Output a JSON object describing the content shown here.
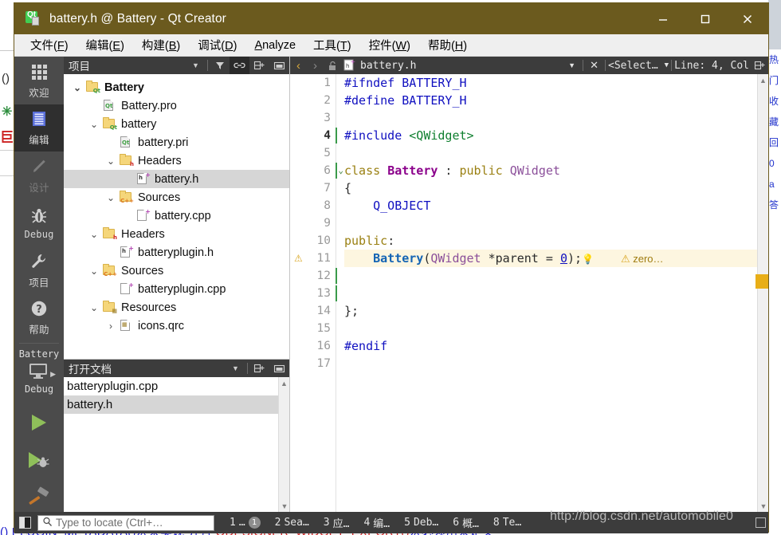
{
  "window": {
    "title": "battery.h @ Battery - Qt Creator",
    "logo_icon": "qt-logo-icon",
    "minimize_icon": "minimize-icon",
    "maximize_icon": "maximize-icon",
    "close_icon": "close-icon"
  },
  "menubar": {
    "items": [
      {
        "pre": "文件(",
        "key": "F",
        "post": ")"
      },
      {
        "pre": "编辑(",
        "key": "E",
        "post": ")"
      },
      {
        "pre": "构建(",
        "key": "B",
        "post": ")"
      },
      {
        "pre": "调试(",
        "key": "D",
        "post": ")"
      },
      {
        "pre": "",
        "key": "A",
        "post": "nalyze"
      },
      {
        "pre": "工具(",
        "key": "T",
        "post": ")"
      },
      {
        "pre": "控件(",
        "key": "W",
        "post": ")"
      },
      {
        "pre": "帮助(",
        "key": "H",
        "post": ")"
      }
    ]
  },
  "modebar": {
    "modes": [
      {
        "label": "欢迎",
        "icon": "grid-icon",
        "state": "normal"
      },
      {
        "label": "编辑",
        "icon": "document-lines-icon",
        "state": "active"
      },
      {
        "label": "设计",
        "icon": "pencil-icon",
        "state": "disabled"
      },
      {
        "label": "Debug",
        "icon": "bug-icon",
        "state": "normal"
      },
      {
        "label": "项目",
        "icon": "wrench-icon",
        "state": "normal"
      },
      {
        "label": "帮助",
        "icon": "question-mark-icon",
        "state": "normal"
      }
    ],
    "kit": {
      "project_name": "Battery",
      "icon": "monitor-icon",
      "arrow_icon": "play-arrow-small-icon",
      "build_config": "Debug"
    },
    "actions": [
      {
        "name": "run-button",
        "icon": "green-play-icon"
      },
      {
        "name": "debug-button",
        "icon": "green-play-bug-icon"
      },
      {
        "name": "build-button",
        "icon": "hammer-icon"
      }
    ]
  },
  "project_panel": {
    "title": "项目",
    "tools": [
      {
        "name": "filter-dropdown-icon",
        "glyph": "▾"
      },
      {
        "name": "filter-icon",
        "glyph": "filter"
      },
      {
        "name": "link-sync-icon",
        "glyph": "link",
        "active": true
      },
      {
        "name": "split-add-icon",
        "glyph": "split"
      },
      {
        "name": "minimize-panel-icon",
        "glyph": "min"
      }
    ],
    "tree": [
      {
        "label": "Battery",
        "indent": 0,
        "arrow": "down",
        "icon": "folder-qt",
        "bold": true,
        "selected": false
      },
      {
        "label": "Battery.pro",
        "indent": 1,
        "arrow": "none",
        "icon": "file-qt",
        "bold": false,
        "selected": false
      },
      {
        "label": "battery",
        "indent": 1,
        "arrow": "down",
        "icon": "folder-qt",
        "bold": false,
        "selected": false
      },
      {
        "label": "battery.pri",
        "indent": 2,
        "arrow": "none",
        "icon": "file-qt",
        "bold": false,
        "selected": false
      },
      {
        "label": "Headers",
        "indent": 2,
        "arrow": "down",
        "icon": "folder-h",
        "bold": false,
        "selected": false
      },
      {
        "label": "battery.h",
        "indent": 3,
        "arrow": "none",
        "icon": "file-h",
        "bold": false,
        "selected": true
      },
      {
        "label": "Sources",
        "indent": 2,
        "arrow": "down",
        "icon": "folder-cpp",
        "bold": false,
        "selected": false
      },
      {
        "label": "battery.cpp",
        "indent": 3,
        "arrow": "none",
        "icon": "file-cpp",
        "bold": false,
        "selected": false
      },
      {
        "label": "Headers",
        "indent": 1,
        "arrow": "down",
        "icon": "folder-h",
        "bold": false,
        "selected": false
      },
      {
        "label": "batteryplugin.h",
        "indent": 2,
        "arrow": "none",
        "icon": "file-h",
        "bold": false,
        "selected": false
      },
      {
        "label": "Sources",
        "indent": 1,
        "arrow": "down",
        "icon": "folder-cpp",
        "bold": false,
        "selected": false
      },
      {
        "label": "batteryplugin.cpp",
        "indent": 2,
        "arrow": "none",
        "icon": "file-cpp",
        "bold": false,
        "selected": false
      },
      {
        "label": "Resources",
        "indent": 1,
        "arrow": "down",
        "icon": "folder-res",
        "bold": false,
        "selected": false
      },
      {
        "label": "icons.qrc",
        "indent": 2,
        "arrow": "right",
        "icon": "file-res",
        "bold": false,
        "selected": false
      }
    ]
  },
  "open_documents": {
    "title": "打开文档",
    "tools": [
      {
        "name": "opendocs-dropdown-icon",
        "glyph": "▾"
      },
      {
        "name": "split-add-icon",
        "glyph": "split"
      },
      {
        "name": "minimize-panel-icon",
        "glyph": "min"
      }
    ],
    "items": [
      {
        "label": "battery.h",
        "selected": true
      },
      {
        "label": "batteryplugin.cpp",
        "selected": false
      }
    ]
  },
  "editor": {
    "toolbar": {
      "back_icon": "chevron-left-icon",
      "forward_icon": "chevron-right-icon",
      "lock_icon": "unlocked-icon",
      "file_icon": "header-file-icon",
      "filename": "battery.h",
      "file_dropdown_icon": "chevron-down-icon",
      "close_icon": "close-icon",
      "symbol_selector": "<Select…",
      "symbol_dropdown_icon": "chevron-down-icon",
      "cursor_position": "Line: 4, Col",
      "split_icon": "split-add-icon"
    },
    "lines": [
      {
        "n": 1,
        "current": false,
        "warning": false,
        "fold": false,
        "mark": false,
        "highlight": false,
        "tokens": [
          {
            "t": "#ifndef ",
            "c": "k-pre"
          },
          {
            "t": "BATTERY_H",
            "c": "k-mac"
          }
        ]
      },
      {
        "n": 2,
        "current": false,
        "warning": false,
        "fold": false,
        "mark": false,
        "highlight": false,
        "tokens": [
          {
            "t": "#define ",
            "c": "k-pre"
          },
          {
            "t": "BATTERY_H",
            "c": "k-mac"
          }
        ]
      },
      {
        "n": 3,
        "current": false,
        "warning": false,
        "fold": false,
        "mark": false,
        "highlight": false,
        "tokens": []
      },
      {
        "n": 4,
        "current": true,
        "warning": false,
        "fold": false,
        "mark": true,
        "highlight": false,
        "tokens": [
          {
            "t": "#include ",
            "c": "k-pre"
          },
          {
            "t": "<QWidget>",
            "c": "k-inc"
          }
        ]
      },
      {
        "n": 5,
        "current": false,
        "warning": false,
        "fold": false,
        "mark": false,
        "highlight": false,
        "tokens": []
      },
      {
        "n": 6,
        "current": false,
        "warning": false,
        "fold": true,
        "mark": true,
        "highlight": false,
        "tokens": [
          {
            "t": "class ",
            "c": "k-kw"
          },
          {
            "t": "Battery",
            "c": "k-cls"
          },
          {
            "t": " : ",
            "c": "k-pun"
          },
          {
            "t": "public ",
            "c": "k-kw"
          },
          {
            "t": "QWidget",
            "c": "k-typ"
          }
        ]
      },
      {
        "n": 7,
        "current": false,
        "warning": false,
        "fold": false,
        "mark": false,
        "highlight": false,
        "tokens": [
          {
            "t": "{",
            "c": "k-pun"
          }
        ]
      },
      {
        "n": 8,
        "current": false,
        "warning": false,
        "fold": false,
        "mark": false,
        "highlight": false,
        "tokens": [
          {
            "t": "    ",
            "c": "k-pun"
          },
          {
            "t": "Q_OBJECT",
            "c": "k-mac"
          }
        ]
      },
      {
        "n": 9,
        "current": false,
        "warning": false,
        "fold": false,
        "mark": false,
        "highlight": false,
        "tokens": []
      },
      {
        "n": 10,
        "current": false,
        "warning": false,
        "fold": false,
        "mark": false,
        "highlight": false,
        "tokens": [
          {
            "t": "public",
            "c": "k-kw"
          },
          {
            "t": ":",
            "c": "k-pun"
          }
        ]
      },
      {
        "n": 11,
        "current": false,
        "warning": true,
        "fold": false,
        "mark": false,
        "highlight": true,
        "tokens": [
          {
            "t": "    ",
            "c": "k-pun"
          },
          {
            "t": "Battery",
            "c": "k-fn"
          },
          {
            "t": "(",
            "c": "k-pun"
          },
          {
            "t": "QWidget",
            "c": "k-typ"
          },
          {
            "t": " *parent = ",
            "c": "k-pun"
          },
          {
            "t": "0",
            "c": "k-num"
          },
          {
            "t": ");",
            "c": "k-pun"
          }
        ],
        "bulb": "lightbulb-icon",
        "warning_text": "zero…"
      },
      {
        "n": 12,
        "current": false,
        "warning": false,
        "fold": false,
        "mark": true,
        "highlight": false,
        "tokens": []
      },
      {
        "n": 13,
        "current": false,
        "warning": false,
        "fold": false,
        "mark": true,
        "highlight": false,
        "tokens": []
      },
      {
        "n": 14,
        "current": false,
        "warning": false,
        "fold": false,
        "mark": false,
        "highlight": false,
        "tokens": [
          {
            "t": "};",
            "c": "k-pun"
          }
        ]
      },
      {
        "n": 15,
        "current": false,
        "warning": false,
        "fold": false,
        "mark": false,
        "highlight": false,
        "tokens": []
      },
      {
        "n": 16,
        "current": false,
        "warning": false,
        "fold": false,
        "mark": false,
        "highlight": false,
        "tokens": [
          {
            "t": "#endif",
            "c": "k-pre"
          }
        ]
      },
      {
        "n": 17,
        "current": false,
        "warning": false,
        "fold": false,
        "mark": false,
        "highlight": false,
        "tokens": []
      }
    ],
    "scroll_up_icon": "chevron-up-icon",
    "scroll_down_icon": "chevron-down-icon"
  },
  "statusbar": {
    "sidebar_toggle_icon": "sidebar-toggle-icon",
    "locator": {
      "search_icon": "search-icon",
      "placeholder": "Type to locate (Ctrl+…",
      "value": ""
    },
    "items": [
      {
        "num": "1",
        "label": "…",
        "badge": "1"
      },
      {
        "num": "2",
        "label": "Sea…",
        "badge": ""
      },
      {
        "num": "3",
        "label": "应…",
        "badge": ""
      },
      {
        "num": "4",
        "label": "编…",
        "badge": ""
      },
      {
        "num": "5",
        "label": "Deb…",
        "badge": ""
      },
      {
        "num": "6",
        "label": "概…",
        "badge": ""
      },
      {
        "num": "8",
        "label": "Te…",
        "badge": ""
      }
    ],
    "progress_icon": "progress-square-icon"
  },
  "watermark": {
    "text": "http://blog.csdn.net/automobile0"
  },
  "background": {
    "bottom_text_parts": [
      {
        "t": "() PLUGIN_METADATA()宏来实现 并且 ",
        "red": false
      },
      {
        "t": "QDESIGNER_WIDGET_EXPORT()",
        "red": true
      },
      {
        "t": "宏必须用来定义",
        "red": false
      }
    ],
    "left_glyphs": [
      "()",
      "✳",
      "E"
    ],
    "right_code_chars": [
      "热",
      "门",
      "收",
      "藏",
      "回",
      "0",
      "a",
      "答"
    ]
  },
  "colors": {
    "title_bar": "#6b5a1e",
    "mode_bar": "#4b4b4b",
    "mode_active": "#2f2f2f",
    "dock_header": "#3c3c3c",
    "selection": "#d6d6d6",
    "warning": "#e8ae17",
    "accent_green": "#41cd52"
  }
}
